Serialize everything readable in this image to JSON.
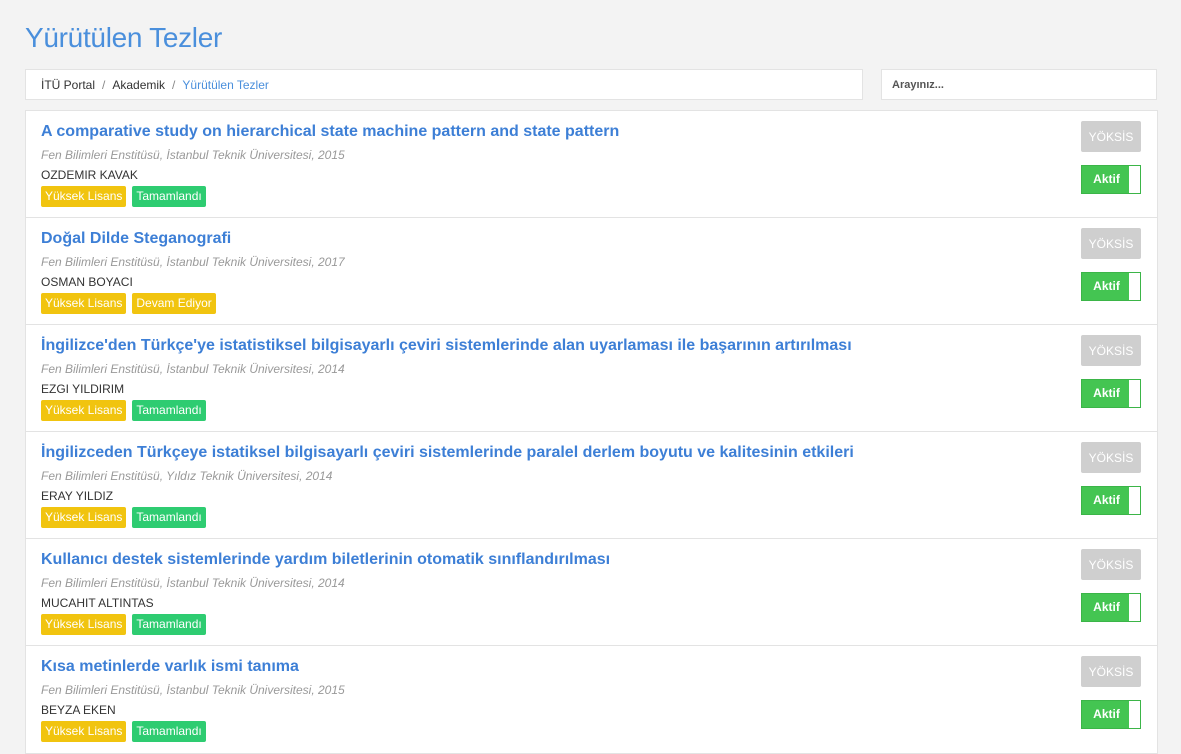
{
  "page_title": "Yürütülen Tezler",
  "breadcrumb": {
    "items": [
      "İTÜ Portal",
      "Akademik"
    ],
    "current": "Yürütülen Tezler",
    "separator": "/"
  },
  "search": {
    "placeholder": "Arayınız..."
  },
  "theses": [
    {
      "title": "A comparative study on hierarchical state machine pattern and state pattern",
      "meta": "Fen Bilimleri Enstitüsü, İstanbul Teknik Üniversitesi, 2015",
      "author": "OZDEMIR KAVAK",
      "level": "Yüksek Lisans",
      "status": "Tamamlandı",
      "status_color": "green",
      "yoksis": "YÖKSİS",
      "toggle": "Aktif"
    },
    {
      "title": "Doğal Dilde Steganografi",
      "meta": "Fen Bilimleri Enstitüsü, İstanbul Teknik Üniversitesi, 2017",
      "author": "OSMAN BOYACI",
      "level": "Yüksek Lisans",
      "status": "Devam Ediyor",
      "status_color": "yellow",
      "yoksis": "YÖKSİS",
      "toggle": "Aktif"
    },
    {
      "title": "İngilizce'den Türkçe'ye istatistiksel bilgisayarlı çeviri sistemlerinde alan uyarlaması ile başarının artırılması",
      "meta": "Fen Bilimleri Enstitüsü, İstanbul Teknik Üniversitesi, 2014",
      "author": "EZGI YILDIRIM",
      "level": "Yüksek Lisans",
      "status": "Tamamlandı",
      "status_color": "green",
      "yoksis": "YÖKSİS",
      "toggle": "Aktif"
    },
    {
      "title": "İngilizceden Türkçeye istatiksel bilgisayarlı çeviri sistemlerinde paralel derlem boyutu ve kalitesinin etkileri",
      "meta": "Fen Bilimleri Enstitüsü, Yıldız Teknik Üniversitesi, 2014",
      "author": "ERAY YILDIZ",
      "level": "Yüksek Lisans",
      "status": "Tamamlandı",
      "status_color": "green",
      "yoksis": "YÖKSİS",
      "toggle": "Aktif"
    },
    {
      "title": "Kullanıcı destek sistemlerinde yardım biletlerinin otomatik sınıflandırılması",
      "meta": "Fen Bilimleri Enstitüsü, İstanbul Teknik Üniversitesi, 2014",
      "author": "MUCAHIT ALTINTAS",
      "level": "Yüksek Lisans",
      "status": "Tamamlandı",
      "status_color": "green",
      "yoksis": "YÖKSİS",
      "toggle": "Aktif"
    },
    {
      "title": "Kısa metinlerde varlık ismi tanıma",
      "meta": "Fen Bilimleri Enstitüsü, İstanbul Teknik Üniversitesi, 2015",
      "author": "BEYZA EKEN",
      "level": "Yüksek Lisans",
      "status": "Tamamlandı",
      "status_color": "green",
      "yoksis": "YÖKSİS",
      "toggle": "Aktif"
    }
  ]
}
